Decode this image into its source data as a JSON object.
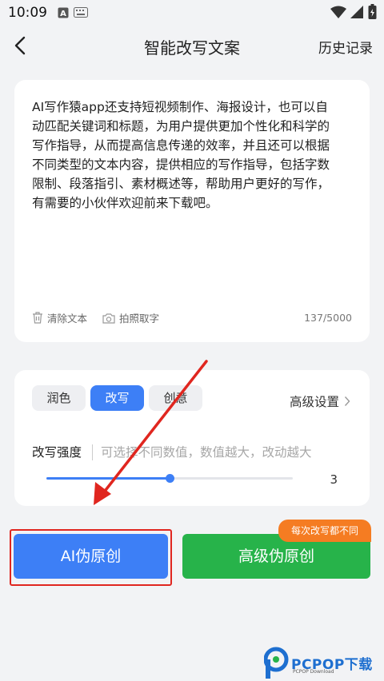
{
  "status_bar": {
    "time": "10:09"
  },
  "header": {
    "title": "智能改写文案",
    "history": "历史记录"
  },
  "editor": {
    "lines": [
      "AI写作猿app还支持短视频制作、海报设计，也可以自",
      "动匹配关键词和标题，为用户提供更加个性化和科学的",
      "写作指导，从而提高信息传递的效率，并且还可以根据",
      "不同类型的文本内容，提供相应的写作指导，包括字数",
      "限制、段落指引、素材概述等，帮助用户更好的写作，",
      "有需要的小伙伴欢迎前来下载吧。"
    ],
    "clear_label": "清除文本",
    "photo_label": "拍照取字",
    "counter": "137/5000"
  },
  "options": {
    "modes": [
      {
        "label": "润色",
        "selected": false
      },
      {
        "label": "改写",
        "selected": true
      },
      {
        "label": "创意",
        "selected": false
      }
    ],
    "advanced_settings": "高级设置",
    "strength_label": "改写强度",
    "strength_hint": "可选择不同数值，数值越大，改动越大",
    "strength_value": "3",
    "strength_fraction": 0.5
  },
  "actions": {
    "ai_button": "AI伪原创",
    "advanced_button": "高级伪原创",
    "badge": "每次改写都不同"
  },
  "watermark": {
    "text": "PCPOP下载",
    "sub": "PCPOP Download"
  },
  "colors": {
    "accent_blue": "#3d7ff6",
    "accent_green": "#27b34a",
    "badge_orange": "#f57c22",
    "annotation_red": "#e0261f"
  }
}
